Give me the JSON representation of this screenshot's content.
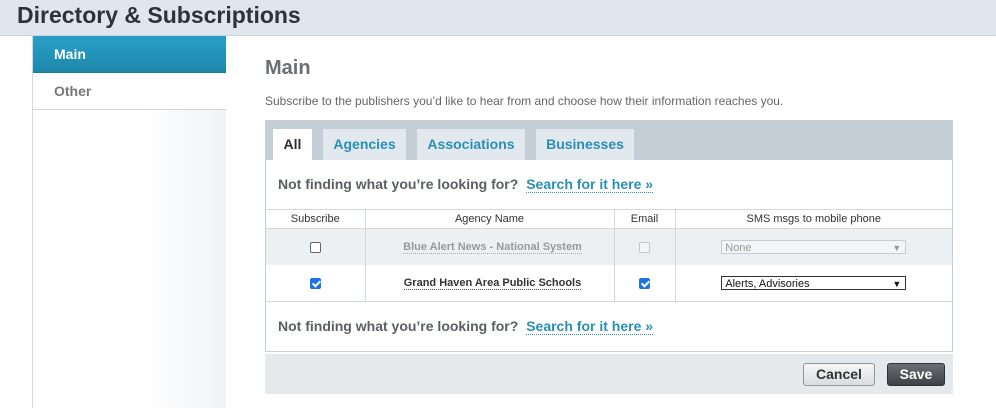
{
  "header": {
    "title": "Directory & Subscriptions"
  },
  "sidebar": {
    "items": [
      {
        "label": "Main",
        "active": true
      },
      {
        "label": "Other",
        "active": false
      }
    ]
  },
  "main": {
    "title": "Main",
    "subtitle": "Subscribe to the publishers you’d like to hear from and choose how their information reaches you."
  },
  "tabs": [
    {
      "label": "All",
      "active": true
    },
    {
      "label": "Agencies",
      "active": false
    },
    {
      "label": "Associations",
      "active": false
    },
    {
      "label": "Businesses",
      "active": false
    }
  ],
  "notfound": {
    "text": "Not finding what you’re looking for?",
    "link": "Search for it here »"
  },
  "table": {
    "columns": [
      "Subscribe",
      "Agency Name",
      "Email",
      "SMS msgs to mobile phone"
    ],
    "rows": [
      {
        "subscribed": false,
        "name": "Blue Alert News - National System",
        "email": false,
        "email_disabled": true,
        "sms": "None",
        "sms_disabled": true
      },
      {
        "subscribed": true,
        "name": "Grand Haven Area Public Schools",
        "email": true,
        "email_disabled": false,
        "sms": "Alerts, Advisories",
        "sms_disabled": false
      }
    ]
  },
  "buttons": {
    "cancel": "Cancel",
    "save": "Save"
  },
  "colors": {
    "accent": "#2aa0c6",
    "link": "#2a8fb5",
    "checkbox": "#1a73e8"
  },
  "icons": {
    "select_chevron": "chevron-down-icon",
    "checkbox_checked": "check-icon"
  }
}
